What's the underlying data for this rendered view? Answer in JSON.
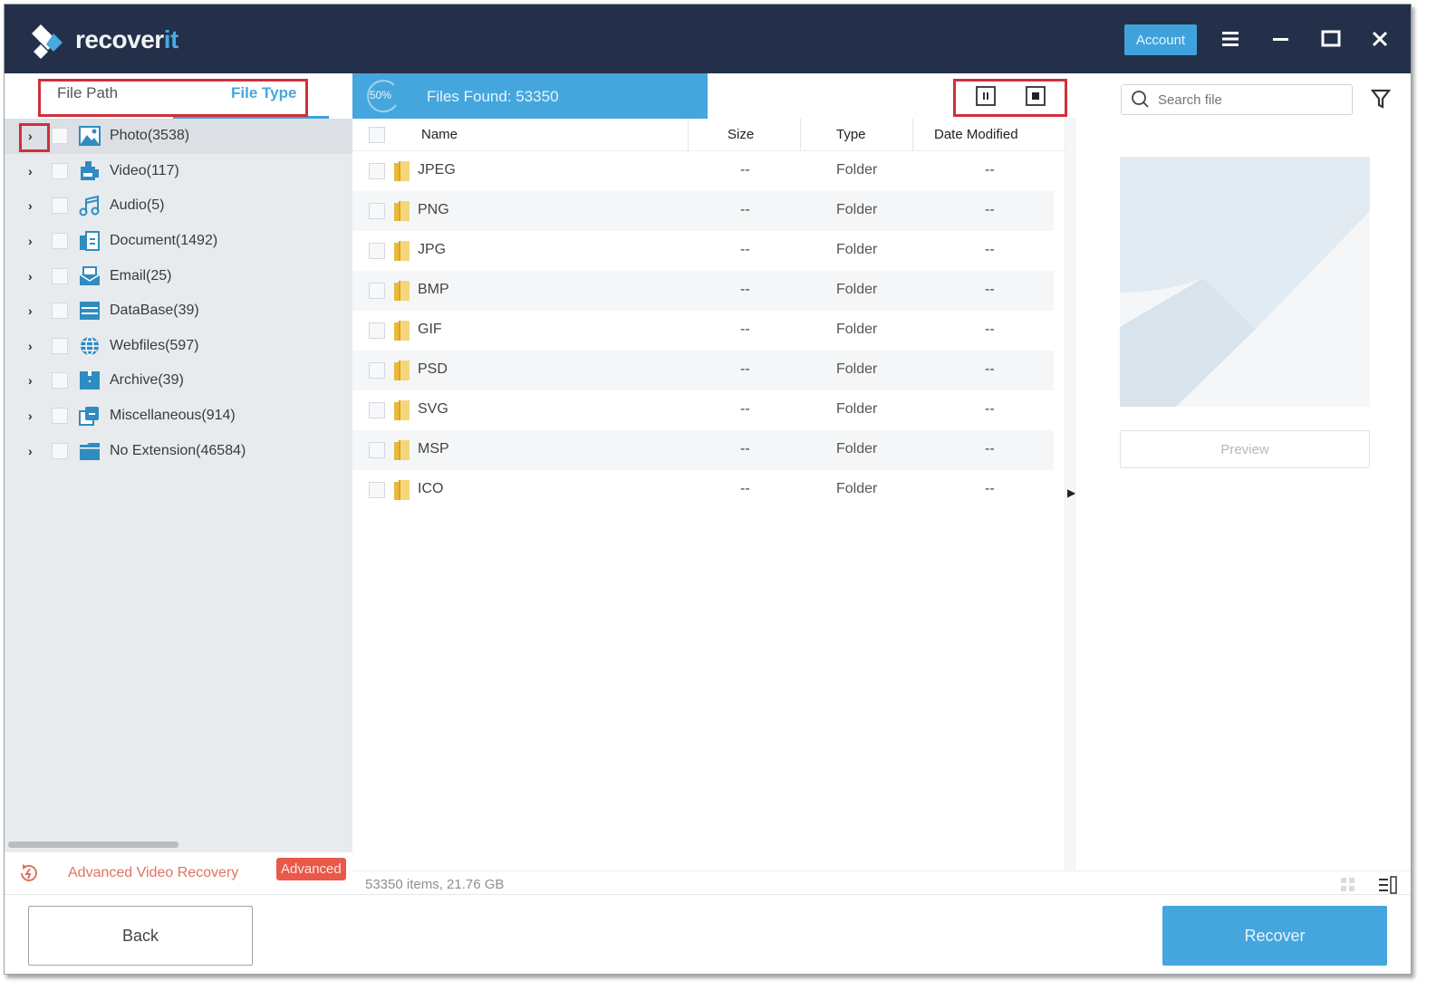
{
  "app": {
    "name_main": "recover",
    "name_accent": "it"
  },
  "titlebar": {
    "account_label": "Account",
    "icons": [
      "menu-icon",
      "minimize-icon",
      "maximize-icon",
      "close-icon"
    ]
  },
  "sidebar": {
    "tabs": [
      {
        "label": "File Path",
        "active": false
      },
      {
        "label": "File Type",
        "active": true
      }
    ],
    "categories": [
      {
        "label": "Photo(3538)",
        "icon": "photo-icon",
        "selected": true
      },
      {
        "label": "Video(117)",
        "icon": "video-icon"
      },
      {
        "label": "Audio(5)",
        "icon": "audio-icon"
      },
      {
        "label": "Document(1492)",
        "icon": "document-icon"
      },
      {
        "label": "Email(25)",
        "icon": "email-icon"
      },
      {
        "label": "DataBase(39)",
        "icon": "database-icon"
      },
      {
        "label": "Webfiles(597)",
        "icon": "globe-icon"
      },
      {
        "label": "Archive(39)",
        "icon": "archive-icon"
      },
      {
        "label": "Miscellaneous(914)",
        "icon": "miscellaneous-icon"
      },
      {
        "label": "No Extension(46584)",
        "icon": "folder-icon"
      }
    ],
    "advanced": {
      "label": "Advanced Video Recovery",
      "badge": "Advanced"
    }
  },
  "scan": {
    "progress_label": "50%",
    "progress_percent": 50,
    "files_found": "Files Found:  53350",
    "pause_icon": "pause-icon",
    "stop_icon": "stop-icon"
  },
  "table": {
    "columns": [
      "Name",
      "Size",
      "Type",
      "Date Modified"
    ],
    "rows": [
      {
        "name": "JPEG",
        "size": "--",
        "type": "Folder",
        "date": "--"
      },
      {
        "name": "PNG",
        "size": "--",
        "type": "Folder",
        "date": "--"
      },
      {
        "name": "JPG",
        "size": "--",
        "type": "Folder",
        "date": "--"
      },
      {
        "name": "BMP",
        "size": "--",
        "type": "Folder",
        "date": "--"
      },
      {
        "name": "GIF",
        "size": "--",
        "type": "Folder",
        "date": "--"
      },
      {
        "name": "PSD",
        "size": "--",
        "type": "Folder",
        "date": "--"
      },
      {
        "name": "SVG",
        "size": "--",
        "type": "Folder",
        "date": "--"
      },
      {
        "name": "MSP",
        "size": "--",
        "type": "Folder",
        "date": "--"
      },
      {
        "name": "ICO",
        "size": "--",
        "type": "Folder",
        "date": "--"
      }
    ]
  },
  "right_pane": {
    "search_placeholder": "Search file",
    "preview_label": "Preview"
  },
  "status": {
    "summary": "53350 items, 21.76  GB"
  },
  "footer": {
    "back_label": "Back",
    "recover_label": "Recover"
  },
  "colors": {
    "titlebar": "#24304a",
    "accent": "#45a6de",
    "highlight": "#cf2f3d",
    "advanced": "#e9594a"
  }
}
